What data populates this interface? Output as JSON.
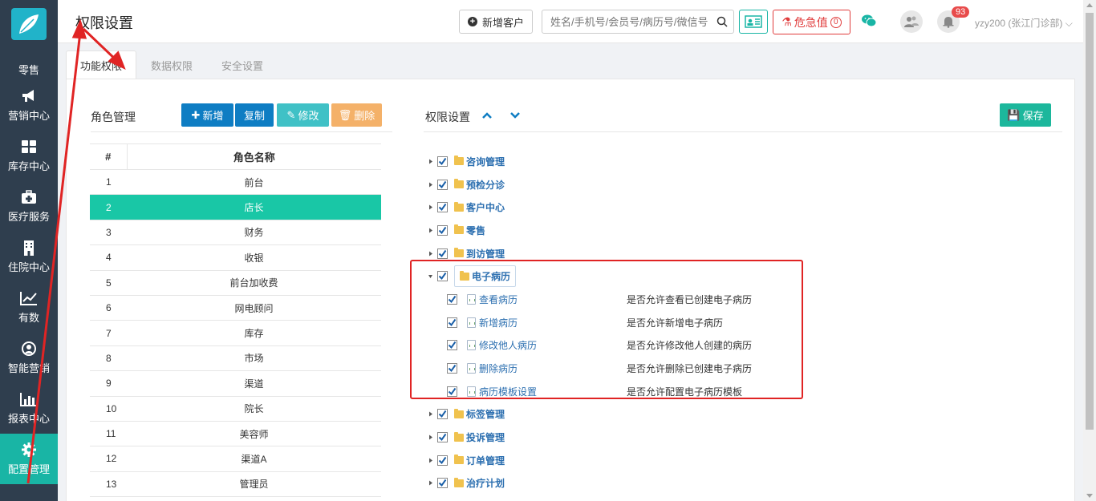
{
  "sidebar": {
    "items": [
      {
        "label": "零售",
        "icon": "retail-icon"
      },
      {
        "label": "营销中心",
        "icon": "megaphone-icon"
      },
      {
        "label": "库存中心",
        "icon": "grid-icon"
      },
      {
        "label": "医疗服务",
        "icon": "medical-kit-icon"
      },
      {
        "label": "住院中心",
        "icon": "building-icon"
      },
      {
        "label": "有数",
        "icon": "line-chart-icon"
      },
      {
        "label": "智能营销",
        "icon": "brain-icon"
      },
      {
        "label": "报表中心",
        "icon": "bar-chart-icon"
      },
      {
        "label": "配置管理",
        "icon": "gear-icon"
      }
    ]
  },
  "header": {
    "title": "权限设置",
    "new_customer": "新增客户",
    "search_placeholder": "姓名/手机号/会员号/病历号/微信号",
    "danger_label": "危急值",
    "danger_count": "0",
    "notification_count": "93",
    "user": "yzy200 (张江门诊部)"
  },
  "tabs": [
    "功能权限",
    "数据权限",
    "安全设置"
  ],
  "roles": {
    "title": "角色管理",
    "buttons": {
      "add": "新增",
      "copy": "复制",
      "edit": "修改",
      "delete": "删除"
    },
    "columns": [
      "#",
      "角色名称"
    ],
    "rows": [
      {
        "num": "1",
        "name": "前台"
      },
      {
        "num": "2",
        "name": "店长"
      },
      {
        "num": "3",
        "name": "财务"
      },
      {
        "num": "4",
        "name": "收银"
      },
      {
        "num": "5",
        "name": "前台加收费"
      },
      {
        "num": "6",
        "name": "网电顾问"
      },
      {
        "num": "7",
        "name": "库存"
      },
      {
        "num": "8",
        "name": "市场"
      },
      {
        "num": "9",
        "name": "渠道"
      },
      {
        "num": "10",
        "name": "院长"
      },
      {
        "num": "11",
        "name": "美容师"
      },
      {
        "num": "12",
        "name": "渠道A"
      },
      {
        "num": "13",
        "name": "管理员"
      }
    ],
    "selected_index": 1
  },
  "permissions": {
    "title": "权限设置",
    "save": "保存",
    "nodes": [
      {
        "label": "咨询管理"
      },
      {
        "label": "预检分诊"
      },
      {
        "label": "客户中心"
      },
      {
        "label": "零售"
      },
      {
        "label": "到访管理"
      },
      {
        "label": "电子病历",
        "children": [
          {
            "label": "查看病历",
            "desc": "是否允许查看已创建电子病历"
          },
          {
            "label": "新增病历",
            "desc": "是否允许新增电子病历"
          },
          {
            "label": "修改他人病历",
            "desc": "是否允许修改他人创建的病历"
          },
          {
            "label": "删除病历",
            "desc": "是否允许删除已创建电子病历"
          },
          {
            "label": "病历模板设置",
            "desc": "是否允许配置电子病历模板"
          }
        ]
      },
      {
        "label": "标签管理"
      },
      {
        "label": "投诉管理"
      },
      {
        "label": "订单管理"
      },
      {
        "label": "治疗计划"
      }
    ]
  },
  "colors": {
    "sidebar": "#2f3e4e",
    "active": "#19b5a5",
    "primary": "#0e7dc3",
    "danger": "#e03c3c",
    "annotation": "#e02424"
  }
}
